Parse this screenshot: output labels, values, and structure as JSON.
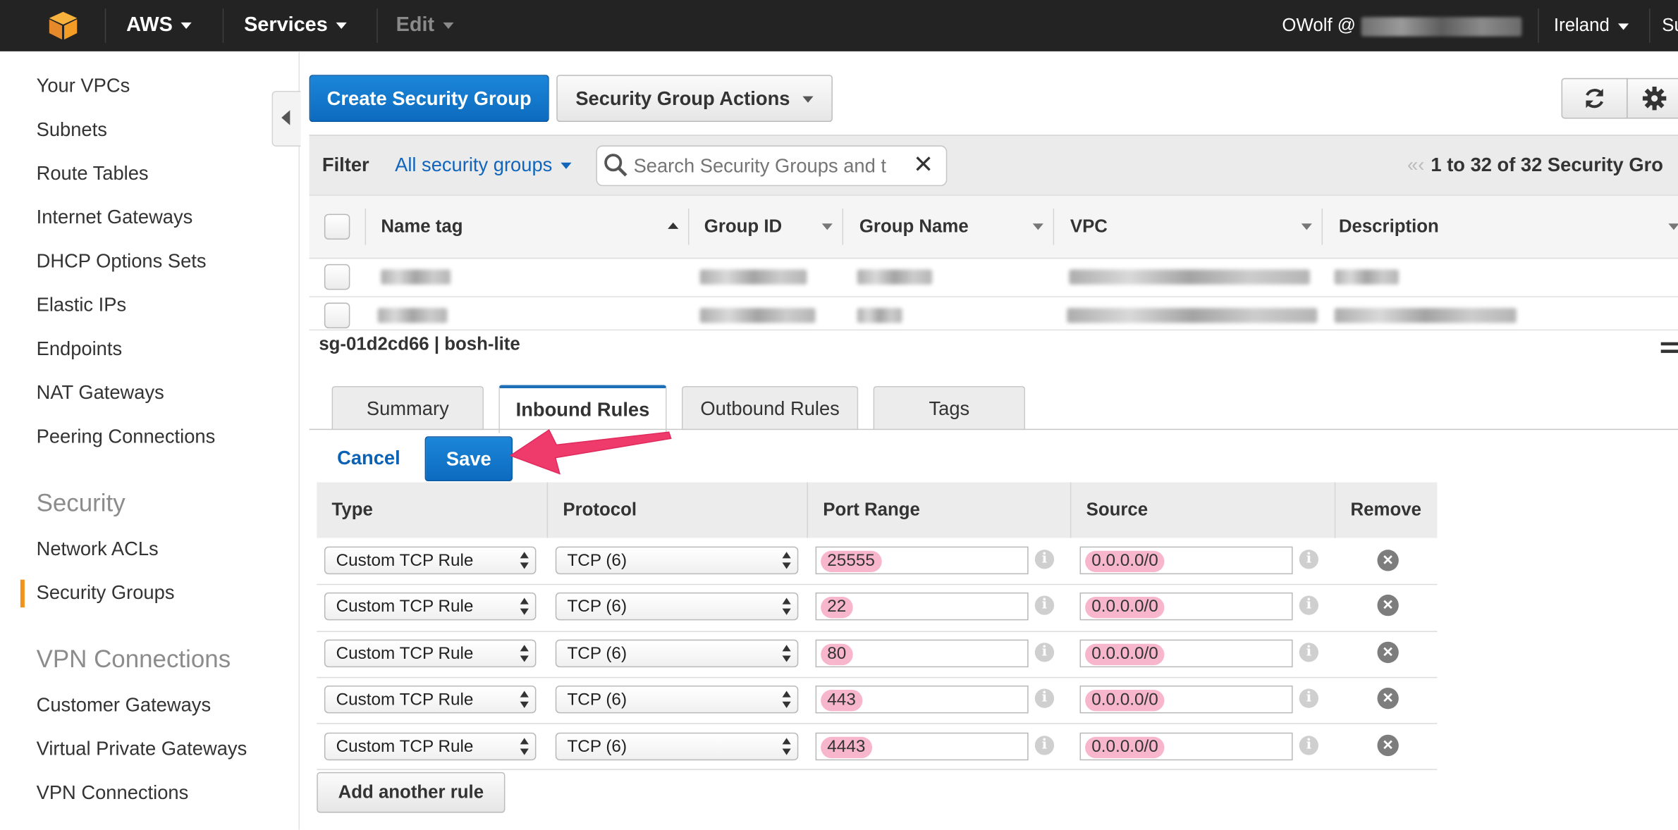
{
  "topbar": {
    "brand": "AWS",
    "services": "Services",
    "edit": "Edit",
    "user": "OWolf @",
    "region": "Ireland",
    "support": "Su"
  },
  "sidebar": {
    "items_top": [
      "Your VPCs",
      "Subnets",
      "Route Tables",
      "Internet Gateways",
      "DHCP Options Sets",
      "Elastic IPs",
      "Endpoints",
      "NAT Gateways",
      "Peering Connections"
    ],
    "security_header": "Security",
    "security_items": [
      "Network ACLs",
      "Security Groups"
    ],
    "vpn_header": "VPN Connections",
    "vpn_items": [
      "Customer Gateways",
      "Virtual Private Gateways",
      "VPN Connections"
    ],
    "active": "Security Groups"
  },
  "toolbar": {
    "create_label": "Create Security Group",
    "actions_label": "Security Group Actions"
  },
  "filter": {
    "label": "Filter",
    "scope": "All security groups",
    "search_placeholder": "Search Security Groups and t",
    "pagination": "1 to 32 of 32 Security Gro"
  },
  "groups_table": {
    "columns": [
      "Name tag",
      "Group ID",
      "Group Name",
      "VPC",
      "Description"
    ]
  },
  "detail": {
    "title": "sg-01d2cd66 | bosh-lite",
    "tabs": [
      "Summary",
      "Inbound Rules",
      "Outbound Rules",
      "Tags"
    ],
    "active_tab": "Inbound Rules",
    "cancel_label": "Cancel",
    "save_label": "Save"
  },
  "rules": {
    "columns": [
      "Type",
      "Protocol",
      "Port Range",
      "Source",
      "Remove"
    ],
    "rows": [
      {
        "type": "Custom TCP Rule",
        "protocol": "TCP (6)",
        "port": "25555",
        "source": "0.0.0.0/0"
      },
      {
        "type": "Custom TCP Rule",
        "protocol": "TCP (6)",
        "port": "22",
        "source": "0.0.0.0/0"
      },
      {
        "type": "Custom TCP Rule",
        "protocol": "TCP (6)",
        "port": "80",
        "source": "0.0.0.0/0"
      },
      {
        "type": "Custom TCP Rule",
        "protocol": "TCP (6)",
        "port": "443",
        "source": "0.0.0.0/0"
      },
      {
        "type": "Custom TCP Rule",
        "protocol": "TCP (6)",
        "port": "4443",
        "source": "0.0.0.0/0"
      }
    ],
    "add_label": "Add another rule"
  },
  "colors": {
    "topbar": "#232323",
    "primary": "#1174c9",
    "link": "#0b62b5",
    "accent_active": "#f0941d",
    "annotation_arrow": "#ef3b6c",
    "highlight": "#f7b6cc"
  }
}
